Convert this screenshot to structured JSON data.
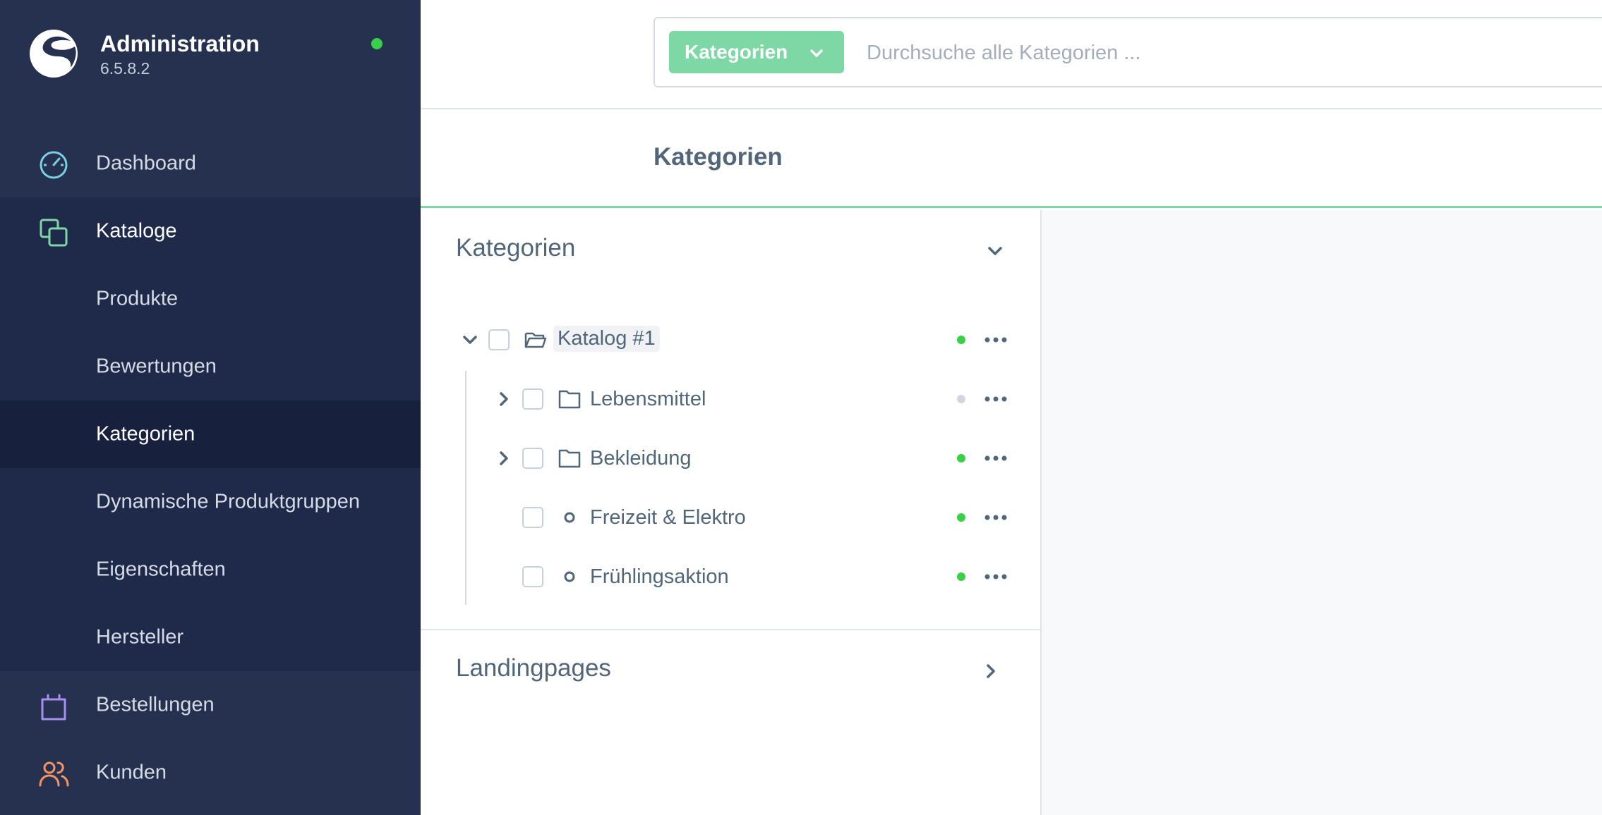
{
  "app": {
    "title": "Administration",
    "version": "6.5.8.2",
    "status_color": "#37d046"
  },
  "sidebar": {
    "items": [
      {
        "label": "Dashboard",
        "icon": "gauge-icon",
        "color": "#7ad0e0"
      },
      {
        "label": "Kataloge",
        "icon": "copy-icon",
        "color": "#7ed8a5"
      },
      {
        "label": "Produkte"
      },
      {
        "label": "Bewertungen"
      },
      {
        "label": "Kategorien"
      },
      {
        "label": "Dynamische Produktgruppen"
      },
      {
        "label": "Eigenschaften"
      },
      {
        "label": "Hersteller"
      },
      {
        "label": "Bestellungen",
        "icon": "shopping-bag-icon",
        "color": "#a88ff0"
      },
      {
        "label": "Kunden",
        "icon": "users-icon",
        "color": "#f59464"
      }
    ]
  },
  "search": {
    "type_label": "Kategorien",
    "placeholder": "Durchsuche alle Kategorien ...",
    "value": ""
  },
  "page": {
    "title": "Kategorien"
  },
  "tree": {
    "section_title": "Kategorien",
    "items": [
      {
        "label": "Katalog #1",
        "active": true
      },
      {
        "label": "Lebensmittel",
        "active": false
      },
      {
        "label": "Bekleidung",
        "active": true
      },
      {
        "label": "Freizeit & Elektro",
        "active": true
      },
      {
        "label": "Frühlingsaktion",
        "active": true
      }
    ],
    "active_color": "#37d046",
    "inactive_color": "#d1d6de"
  },
  "landingpages": {
    "section_title": "Landingpages"
  }
}
